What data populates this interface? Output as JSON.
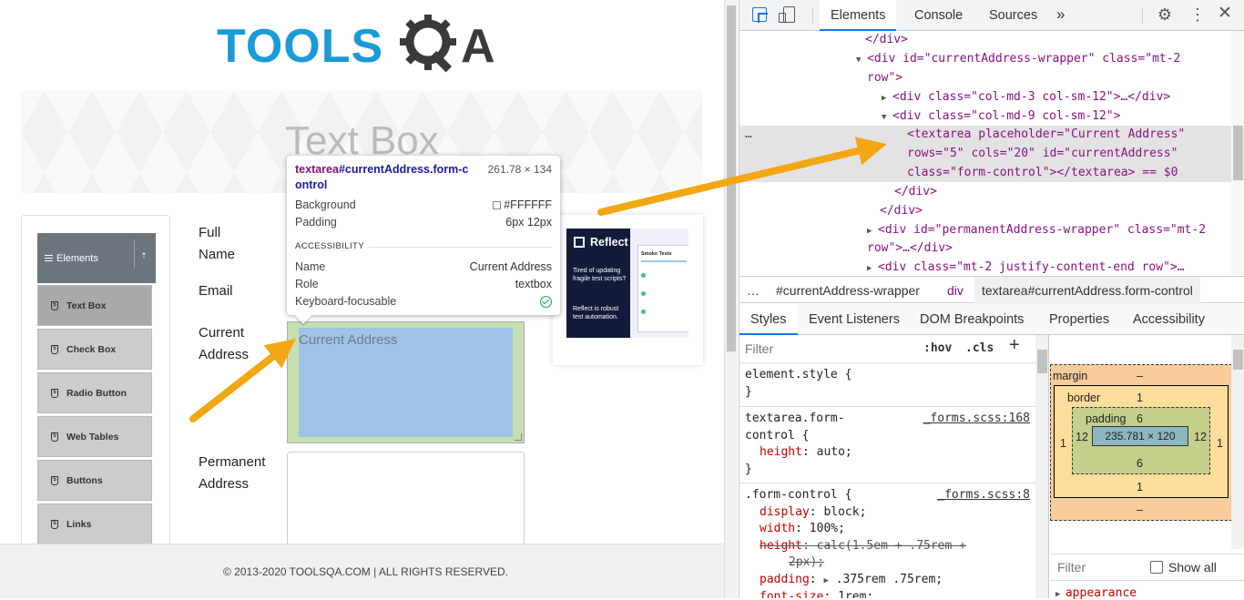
{
  "logo_text": "TOOLSQA",
  "banner": {
    "title": "Text Box"
  },
  "sidebar": {
    "group_label": "Elements",
    "items": [
      {
        "label": "Text Box",
        "active": true
      },
      {
        "label": "Check Box"
      },
      {
        "label": "Radio Button"
      },
      {
        "label": "Web Tables"
      },
      {
        "label": "Buttons"
      },
      {
        "label": "Links"
      }
    ]
  },
  "form": {
    "full_name_label_1": "Full",
    "full_name_label_2": "Name",
    "email_label": "Email",
    "current_label_1": "Current",
    "current_label_2": "Address",
    "current_placeholder": "Current Address",
    "permanent_label_1": "Permanent",
    "permanent_label_2": "Address"
  },
  "tooltip": {
    "element_tag": "textarea",
    "element_id_class_1": "#currentAddress.form-c",
    "element_id_class_2": "ontrol",
    "size": "261.78 × 134",
    "background_label": "Background",
    "background_value": "#FFFFFF",
    "padding_label": "Padding",
    "padding_value": "6px 12px",
    "accessibility_heading": "ACCESSIBILITY",
    "name_label": "Name",
    "name_value": "Current Address",
    "role_label": "Role",
    "role_value": "textbox",
    "focusable_label": "Keyboard-focusable"
  },
  "ad": {
    "brand": "Reflect",
    "text_1": "Tired of updating fragile test scripts?",
    "text_2": "Reflect is robust test automation.",
    "card_title": "Smoke Tests"
  },
  "footer": {
    "text": "© 2013-2020 TOOLSQA.COM | ALL RIGHTS RESERVED."
  },
  "devtools": {
    "tabs": [
      "Elements",
      "Console",
      "Sources"
    ],
    "more_tabs": "»",
    "dom_lines": [
      "</div>",
      "<div id=\"currentAddress-wrapper\" class=\"mt-2",
      "row\">",
      "<div class=\"col-md-3 col-sm-12\">…</div>",
      "<div class=\"col-md-9 col-sm-12\">",
      "<textarea placeholder=\"Current Address\"",
      "rows=\"5\" cols=\"20\" id=\"currentAddress\"",
      "class=\"form-control\"></textarea> == $0",
      "</div>",
      "</div>",
      "<div id=\"permanentAddress-wrapper\" class=\"mt-2",
      "row\">…</div>",
      "<div class=\"mt-2 justify-content-end row\">…"
    ],
    "dom_ellipsis": "…",
    "breadcrumbs": [
      "…",
      "#currentAddress-wrapper",
      "div",
      "textarea#currentAddress.form-control"
    ],
    "sub_tabs": [
      "Styles",
      "Event Listeners",
      "DOM Breakpoints",
      "Properties",
      "Accessibility"
    ],
    "filter_placeholder": "Filter",
    "hov": ":hov",
    "cls": ".cls",
    "plus": "+",
    "rules": {
      "r1_selector": "element.style {",
      "r1_close": "}",
      "r2_selector_1": "textarea.form-",
      "r2_selector_2": "control {",
      "r2_source": "_forms.scss:168",
      "r2_prop": "height",
      "r2_val": "auto;",
      "r2_close": "}",
      "r3_selector": ".form-control {",
      "r3_source": "_forms.scss:8",
      "r3_p1": "display",
      "r3_v1": "block;",
      "r3_p2": "width",
      "r3_v2": "100%;",
      "r3_p3": "height",
      "r3_v3a": "calc(1.5em + .75rem +",
      "r3_v3b": "2px);",
      "r3_p4": "padding",
      "r3_v4": ".375rem .75rem;",
      "r3_p5": "font-size",
      "r3_v5": "1rem;"
    },
    "box_model": {
      "margin_label": "margin",
      "margin_value": "–",
      "margin_bottom": "–",
      "border_label": "border",
      "border_top": "1",
      "border_bottom": "1",
      "border_left": "1",
      "border_right": "1",
      "padding_label": "padding",
      "padding_top": "6",
      "padding_bottom": "6",
      "padding_left": "12",
      "padding_right": "12",
      "content": "235.781 × 120"
    },
    "computed_filter": "Filter",
    "show_all": "Show all",
    "appearance": "appearance"
  }
}
